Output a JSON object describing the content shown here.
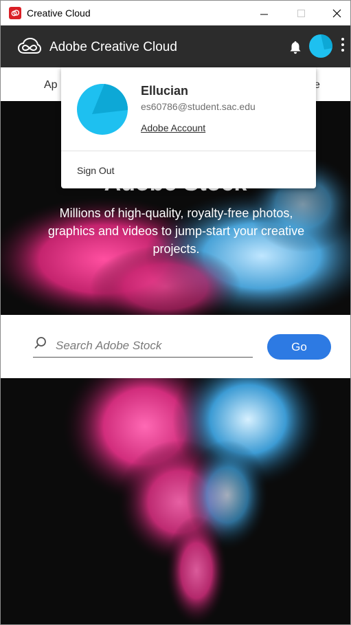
{
  "window": {
    "title": "Creative Cloud"
  },
  "header": {
    "title": "Adobe Creative Cloud"
  },
  "tabs": {
    "left_partial": "Ap",
    "right_partial": "e"
  },
  "hero": {
    "title": "Adobe Stock",
    "subtitle": "Millions of high-quality, royalty-free photos, graphics and videos to jump-start your creative projects."
  },
  "search": {
    "placeholder": "Search Adobe Stock",
    "value": "",
    "go_label": "Go"
  },
  "account_popup": {
    "name": "Ellucian",
    "email": "es60786@student.sac.edu",
    "account_link": "Adobe Account",
    "sign_out": "Sign Out"
  },
  "colors": {
    "header_bg": "#2c2c2c",
    "accent_blue": "#2d7ae3",
    "avatar_cyan": "#1ec0f0",
    "app_icon_red": "#da1f26"
  },
  "icons": [
    "cc-app-icon",
    "creative-cloud-logo-icon",
    "bell-icon",
    "avatar",
    "more-vertical-icon",
    "search-icon",
    "minimize-icon",
    "maximize-icon",
    "close-icon"
  ]
}
